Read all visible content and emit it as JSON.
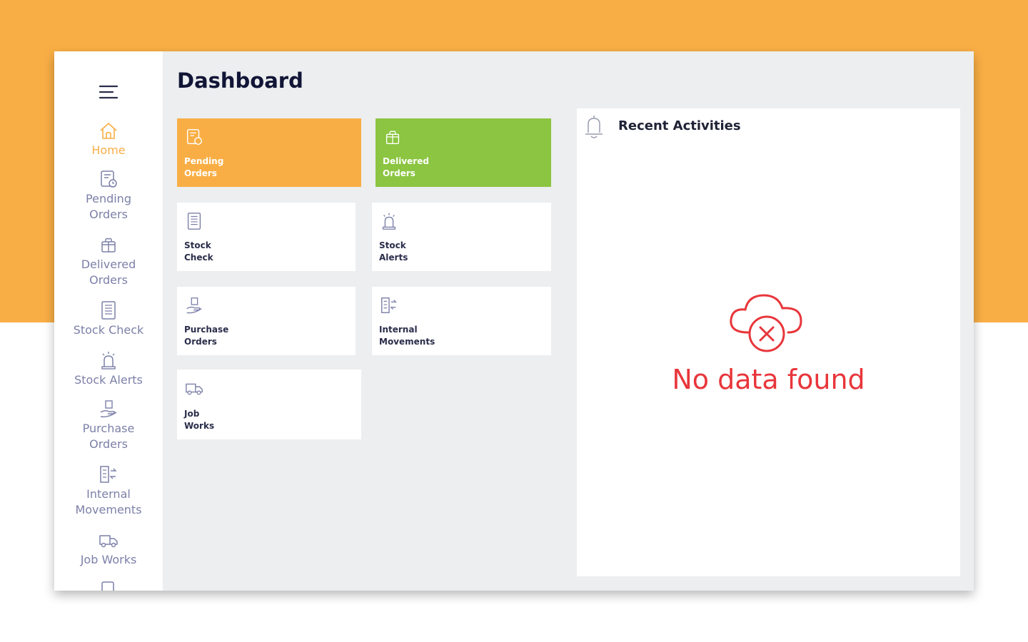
{
  "app": {
    "title": "Dashboard"
  },
  "colors": {
    "accent_orange": "#f9ae45",
    "accent_green": "#8bc541",
    "error_red": "#e8363b",
    "sidebar_text": "#7c80a8"
  },
  "sidebar": {
    "menu_icon": "hamburger-menu-icon",
    "items": [
      {
        "label": "Home",
        "icon": "home-icon",
        "active": true
      },
      {
        "label": "Pending\nOrders",
        "icon": "pending-orders-icon"
      },
      {
        "label": "Delivered\nOrders",
        "icon": "delivered-orders-icon"
      },
      {
        "label": "Stock Check",
        "icon": "stock-check-icon"
      },
      {
        "label": "Stock Alerts",
        "icon": "stock-alerts-icon"
      },
      {
        "label": "Purchase\nOrders",
        "icon": "purchase-orders-icon"
      },
      {
        "label": "Internal\nMovements",
        "icon": "internal-movements-icon"
      },
      {
        "label": "Job Works",
        "icon": "job-works-icon"
      }
    ]
  },
  "tiles": [
    {
      "label": "Pending\nOrders",
      "icon": "pending-orders-icon",
      "color": "#f9ae45"
    },
    {
      "label": "Delivered\nOrders",
      "icon": "delivered-orders-icon",
      "color": "#8bc541"
    },
    {
      "label": "Stock\nCheck",
      "icon": "stock-check-icon"
    },
    {
      "label": "Stock\nAlerts",
      "icon": "stock-alerts-icon"
    },
    {
      "label": "Purchase\nOrders",
      "icon": "purchase-orders-icon"
    },
    {
      "label": "Internal\nMovements",
      "icon": "internal-movements-icon"
    },
    {
      "label": "Job\nWorks",
      "icon": "job-works-icon"
    }
  ],
  "activities": {
    "title": "Recent Activities",
    "icon": "bell-icon",
    "empty_icon": "cloud-error-icon",
    "empty_text": "No data found"
  }
}
